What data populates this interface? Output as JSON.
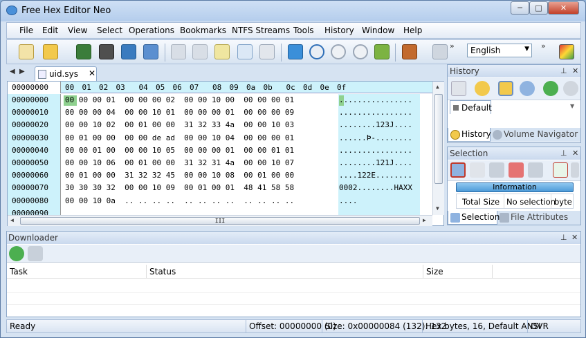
{
  "window": {
    "title": "Free Hex Editor Neo",
    "min": "─",
    "max": "□",
    "close": "✕"
  },
  "menu": [
    "File",
    "Edit",
    "View",
    "Select",
    "Operations",
    "Bookmarks",
    "NTFS Streams",
    "Tools",
    "History",
    "Window",
    "Help"
  ],
  "toolbar": {
    "language": "English",
    "overflow": "»"
  },
  "editor": {
    "tab_name": "uid.sys",
    "tab_close": "✕",
    "offset_header": "00000000",
    "col_headers": [
      "00",
      "01",
      "02",
      "03",
      "04",
      "05",
      "06",
      "07",
      "08",
      "09",
      "0a",
      "0b",
      "0c",
      "0d",
      "0e",
      "0f"
    ],
    "rows": [
      {
        "off": "00000000",
        "hex": "00 00 00 01  00 00 00 02  00 00 10 00  00 00 00 01",
        "ascii": "................"
      },
      {
        "off": "00000010",
        "hex": "00 00 00 04  00 00 10 01  00 00 00 01  00 00 00 09",
        "ascii": "................"
      },
      {
        "off": "00000020",
        "hex": "00 00 10 02  00 01 00 00  31 32 33 4a  00 00 10 03",
        "ascii": "........123J...."
      },
      {
        "off": "00000030",
        "hex": "00 01 00 00  00 00 de ad  00 00 10 04  00 00 00 01",
        "ascii": "......Þ-........"
      },
      {
        "off": "00000040",
        "hex": "00 00 01 00  00 00 10 05  00 00 00 01  00 00 01 01",
        "ascii": "................"
      },
      {
        "off": "00000050",
        "hex": "00 00 10 06  00 01 00 00  31 32 31 4a  00 00 10 07",
        "ascii": "........121J...."
      },
      {
        "off": "00000060",
        "hex": "00 01 00 00  31 32 32 45  00 00 10 08  00 01 00 00",
        "ascii": "....122E........"
      },
      {
        "off": "00000070",
        "hex": "30 30 30 32  00 00 10 09  00 01 00 01  48 41 58 58",
        "ascii": "0002........HAXX"
      },
      {
        "off": "00000080",
        "hex": "00 00 10 0a  .. .. .. ..  .. .. .. ..  .. .. .. ..",
        "ascii": "....            "
      },
      {
        "off": "00000090",
        "hex": "",
        "ascii": ""
      }
    ],
    "hscroll_grip": "III"
  },
  "history": {
    "title": "History",
    "pin": "⊥",
    "close": "✕",
    "branch": "Default",
    "tabs": [
      "History",
      "Volume Navigator"
    ]
  },
  "selection": {
    "title": "Selection",
    "pin": "⊥",
    "close": "✕",
    "info_header": "Information",
    "cols": [
      "Total Size",
      "No selection",
      "byte"
    ],
    "tabs": [
      "Selection",
      "File Attributes"
    ]
  },
  "downloader": {
    "title": "Downloader",
    "pin": "⊥",
    "close": "✕",
    "columns": [
      "Task",
      "Status",
      "Size"
    ]
  },
  "status": {
    "ready": "Ready",
    "offset": "Offset: 00000000 (0)",
    "size": "Size: 0x00000084 (132): 132",
    "mode": "Hex bytes, 16, Default ANSI",
    "ovr": "OVR"
  }
}
